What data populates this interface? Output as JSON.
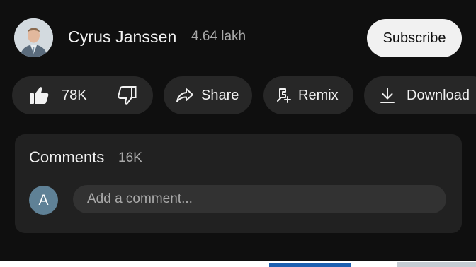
{
  "channel": {
    "name": "Cyrus Janssen",
    "subscribers": "4.64 lakh",
    "subscribe_label": "Subscribe"
  },
  "actions": {
    "like_count": "78K",
    "share_label": "Share",
    "remix_label": "Remix",
    "download_label": "Download"
  },
  "comments": {
    "title": "Comments",
    "count": "16K",
    "user_initial": "A",
    "placeholder": "Add a comment..."
  },
  "icons": {
    "avatar": "channel-avatar",
    "like": "thumbs-up-icon",
    "dislike": "thumbs-down-icon",
    "share": "share-arrow-icon",
    "remix": "remix-icon",
    "download": "download-icon"
  },
  "colors": {
    "background": "#0f0f0f",
    "chip": "#272727",
    "card": "#212121",
    "input": "#323232",
    "subscribe_bg": "#f1f1f1",
    "user_avatar": "#5f8196"
  }
}
